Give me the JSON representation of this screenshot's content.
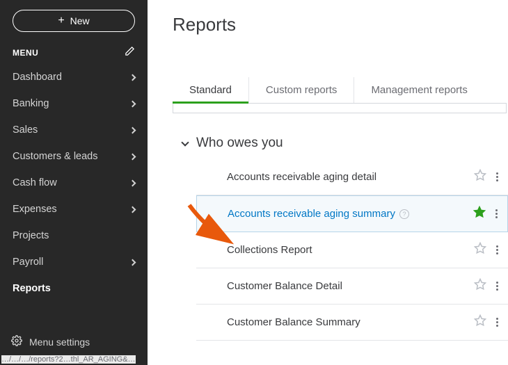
{
  "sidebar": {
    "new_label": "New",
    "menu_label": "MENU",
    "settings_label": "Menu settings",
    "items": [
      {
        "label": "Dashboard",
        "has_children": true,
        "active": false
      },
      {
        "label": "Banking",
        "has_children": true,
        "active": false
      },
      {
        "label": "Sales",
        "has_children": true,
        "active": false
      },
      {
        "label": "Customers & leads",
        "has_children": true,
        "active": false
      },
      {
        "label": "Cash flow",
        "has_children": true,
        "active": false
      },
      {
        "label": "Expenses",
        "has_children": true,
        "active": false
      },
      {
        "label": "Projects",
        "has_children": false,
        "active": false
      },
      {
        "label": "Payroll",
        "has_children": true,
        "active": false
      },
      {
        "label": "Reports",
        "has_children": false,
        "active": true
      }
    ]
  },
  "main": {
    "title": "Reports",
    "tabs": [
      {
        "label": "Standard",
        "active": true
      },
      {
        "label": "Custom reports",
        "active": false
      },
      {
        "label": "Management reports",
        "active": false
      }
    ],
    "section_title": "Who owes you",
    "reports": [
      {
        "name": "Accounts receivable aging detail",
        "starred": false,
        "highlight": false
      },
      {
        "name": "Accounts receivable aging summary",
        "starred": true,
        "highlight": true
      },
      {
        "name": "Collections Report",
        "starred": false,
        "highlight": false
      },
      {
        "name": "Customer Balance Detail",
        "starred": false,
        "highlight": false
      },
      {
        "name": "Customer Balance Summary",
        "starred": false,
        "highlight": false
      }
    ]
  },
  "footer_url": "…/…/…/reports?2…thl_AR_AGING&…"
}
